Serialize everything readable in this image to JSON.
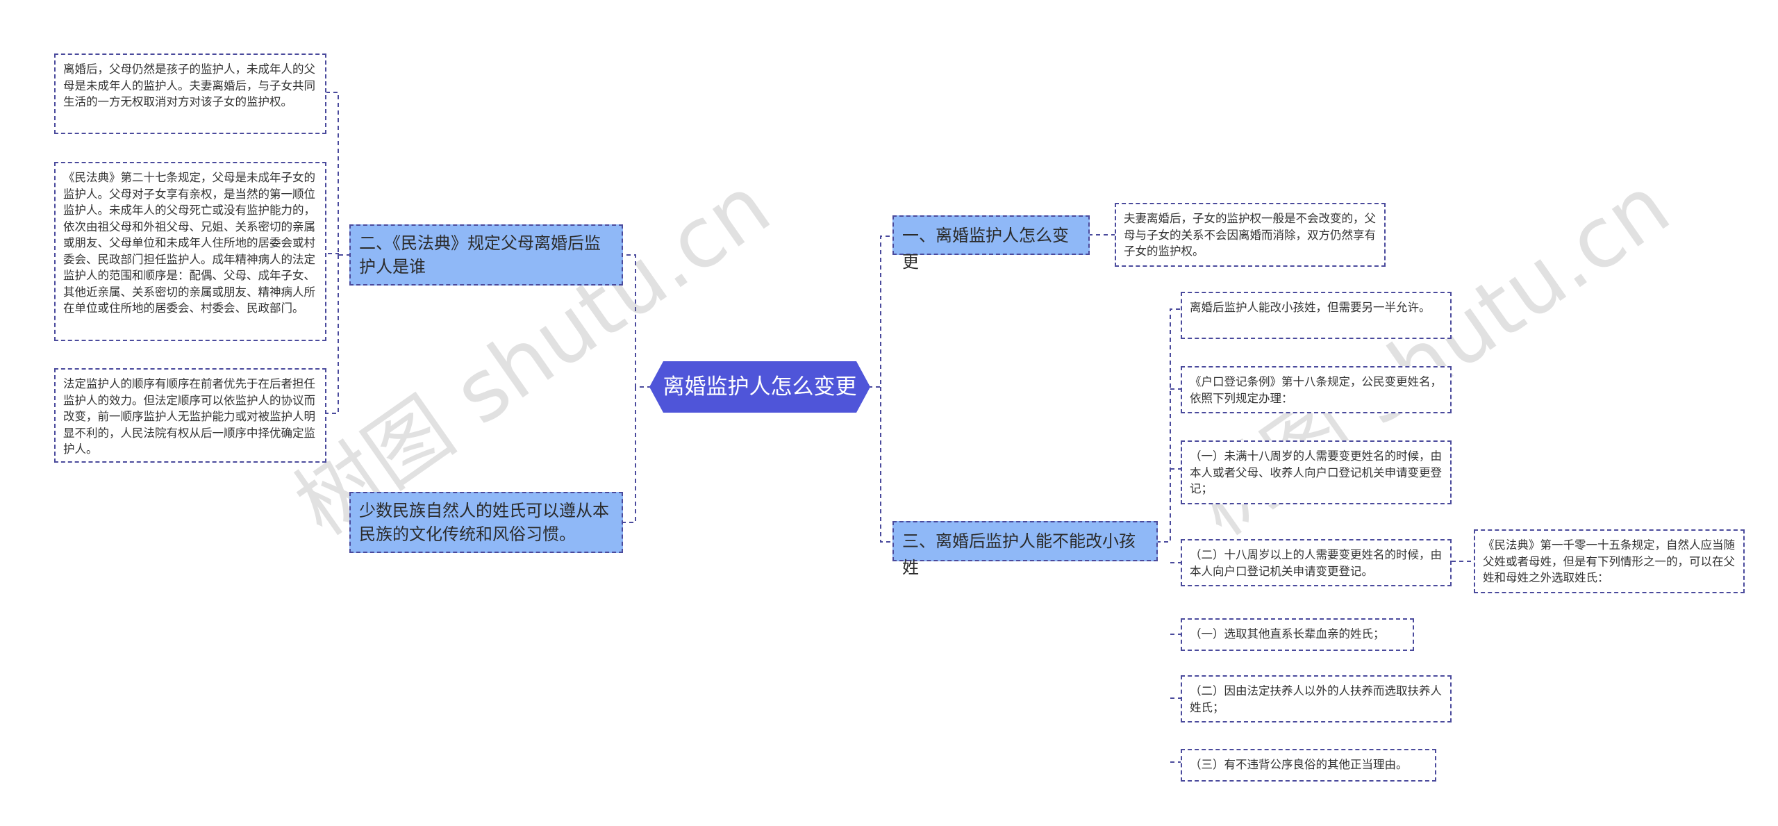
{
  "root": "离婚监护人怎么变更",
  "branches": {
    "b1": "一、离婚监护人怎么变更",
    "b2": "二、《民法典》规定父母离婚后监护人是谁",
    "b3": "三、离婚后监护人能不能改小孩姓",
    "b4": "少数民族自然人的姓氏可以遵从本民族的文化传统和风俗习惯。"
  },
  "leaves": {
    "l1": "夫妻离婚后，子女的监护权一般是不会改变的，父母与子女的关系不会因离婚而消除，双方仍然享有子女的监护权。",
    "l2": "离婚后，父母仍然是孩子的监护人，未成年人的父母是未成年人的监护人。夫妻离婚后，与子女共同生活的一方无权取消对方对该子女的监护权。",
    "l3": "《民法典》第二十七条规定，父母是未成年子女的监护人。父母对子女享有亲权，是当然的第一顺位监护人。未成年人的父母死亡或没有监护能力的，依次由祖父母和外祖父母、兄姐、关系密切的亲属或朋友、父母单位和未成年人住所地的居委会或村委会、民政部门担任监护人。成年精神病人的法定监护人的范围和顺序是：配偶、父母、成年子女、其他近亲属、关系密切的亲属或朋友、精神病人所在单位或住所地的居委会、村委会、民政部门。",
    "l4": "法定监护人的顺序有顺序在前者优先于在后者担任监护人的效力。但法定顺序可以依监护人的协议而改变，前一顺序监护人无监护能力或对被监护人明显不利的，人民法院有权从后一顺序中择优确定监护人。",
    "l5": "离婚后监护人能改小孩姓，但需要另一半允许。",
    "l6": "《户口登记条例》第十八条规定，公民变更姓名，依照下列规定办理：",
    "l7": "（一）未满十八周岁的人需要变更姓名的时候，由本人或者父母、收养人向户口登记机关申请变更登记；",
    "l8": "（二）十八周岁以上的人需要变更姓名的时候，由本人向户口登记机关申请变更登记。",
    "l9": "《民法典》第一千零一十五条规定，自然人应当随父姓或者母姓，但是有下列情形之一的，可以在父姓和母姓之外选取姓氏：",
    "l10": "（一）选取其他直系长辈血亲的姓氏；",
    "l11": "（二）因由法定扶养人以外的人扶养而选取扶养人姓氏；",
    "l12": "（三）有不违背公序良俗的其他正当理由。"
  },
  "watermark": "树图 shutu.cn",
  "colors": {
    "root": "#4f55d9",
    "branch": "#8fb8f7",
    "border": "#4a4a9c"
  }
}
